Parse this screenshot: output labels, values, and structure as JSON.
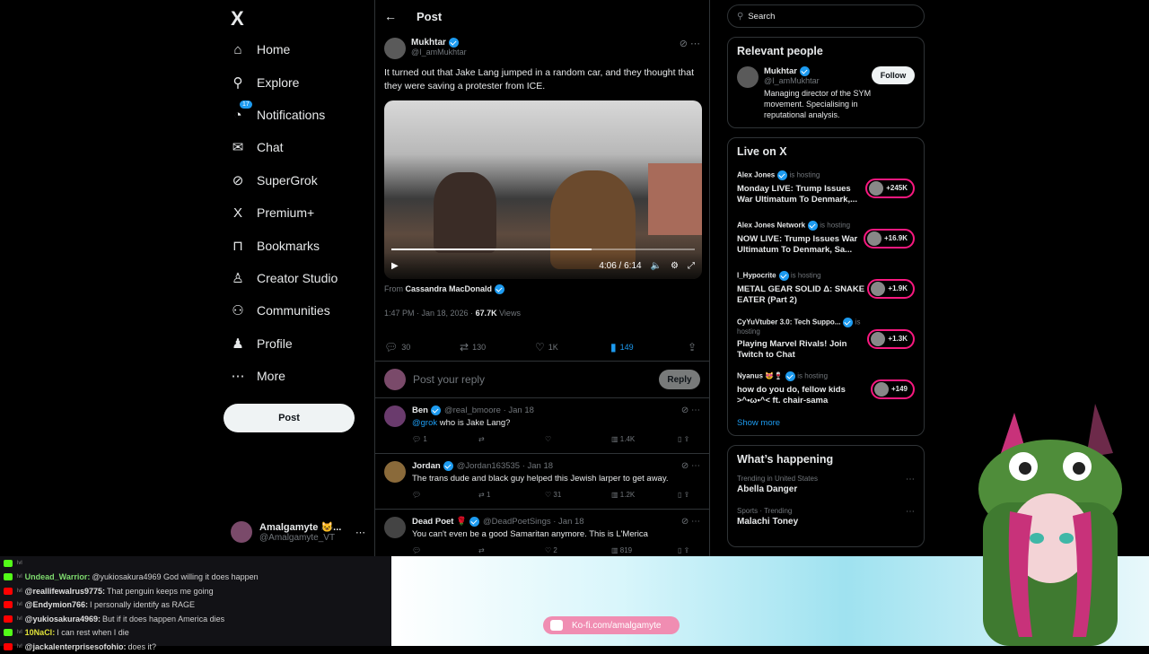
{
  "nav": {
    "logo": "X",
    "items": [
      {
        "label": "Home",
        "icon": "home-icon",
        "glyph": "⌂"
      },
      {
        "label": "Explore",
        "icon": "search-icon",
        "glyph": "⚲"
      },
      {
        "label": "Notifications",
        "icon": "bell-icon",
        "glyph": "🔔",
        "badge": "17"
      },
      {
        "label": "Chat",
        "icon": "mail-icon",
        "glyph": "✉"
      },
      {
        "label": "SuperGrok",
        "icon": "grok-icon",
        "glyph": "⊘"
      },
      {
        "label": "Premium+",
        "icon": "x-icon",
        "glyph": "X"
      },
      {
        "label": "Bookmarks",
        "icon": "bookmark-icon",
        "glyph": "⊓"
      },
      {
        "label": "Creator Studio",
        "icon": "creator-icon",
        "glyph": "♙"
      },
      {
        "label": "Communities",
        "icon": "communities-icon",
        "glyph": "⚇"
      },
      {
        "label": "Profile",
        "icon": "profile-icon",
        "glyph": "♟"
      },
      {
        "label": "More",
        "icon": "more-icon",
        "glyph": "⋯"
      }
    ],
    "post_label": "Post",
    "account": {
      "name": "Amalgamyte 😺...",
      "handle": "@Amalgamyte_VT"
    }
  },
  "main": {
    "title": "Post",
    "post": {
      "name": "Mukhtar",
      "handle": "@I_amMukhtar",
      "text": "It turned out that Jake Lang jumped in a random car, and they thought that they were saving a protester from ICE.",
      "video_time": "4:06 / 6:14",
      "video_progress": 0.66,
      "from_label": "From",
      "from_name": "Cassandra MacDonald",
      "date": "1:47 PM · Jan 18, 2026 · ",
      "views_count": "67.7K",
      "views_label": " Views",
      "replies": "30",
      "reposts": "130",
      "likes": "1K",
      "bookmarks": "149"
    },
    "reply_placeholder": "Post your reply",
    "reply_button": "Reply",
    "replies": [
      {
        "name": "Ben",
        "handle": "@real_bmoore · Jan 18",
        "mention": "@grok",
        "text": " who is Jake Lang?",
        "r": "1",
        "rt": "",
        "l": "",
        "v": "1.4K"
      },
      {
        "name": "Jordan",
        "handle": "@Jordan163535 · Jan 18",
        "mention": "",
        "text": "The trans dude and black guy helped this Jewish larper to get away.",
        "r": "",
        "rt": "1",
        "l": "31",
        "v": "1.2K"
      },
      {
        "name": "Dead Poet 🌹",
        "handle": "@DeadPoetSings · Jan 18",
        "mention": "",
        "text": "You can't even be a good Samaritan anymore. This is L'Merica",
        "r": "",
        "rt": "",
        "l": "2",
        "v": "819"
      }
    ]
  },
  "right": {
    "search_placeholder": "Search",
    "relevant_title": "Relevant people",
    "relevant": {
      "name": "Mukhtar",
      "handle": "@I_amMukhtar",
      "bio": "Managing director of the SYM movement. Specialising in reputational analysis.",
      "follow": "Follow"
    },
    "live_title": "Live on X",
    "is_hosting": "is hosting",
    "live": [
      {
        "host": "Alex Jones",
        "title": "Monday LIVE: Trump Issues War Ultimatum To Denmark,...",
        "count": "+245K"
      },
      {
        "host": "Alex Jones Network",
        "title": "NOW LIVE: Trump Issues War Ultimatum To Denmark, Sa...",
        "count": "+16.9K"
      },
      {
        "host": "I_Hypocrite",
        "title": "METAL GEAR SOLID Δ: SNAKE EATER (Part 2)",
        "count": "+1.9K"
      },
      {
        "host": "CyYuVtuber 3.0: Tech Suppo...",
        "title": "Playing Marvel Rivals! Join Twitch to Chat",
        "count": "+1.3K"
      },
      {
        "host": "Nyanus 😻🍷",
        "title": "how do you do, fellow kids >^•ω•^< ft. chair-sama",
        "count": "+149"
      }
    ],
    "show_more": "Show more",
    "happening_title": "What’s happening",
    "trends": [
      {
        "cat": "Trending in United States",
        "name": "Abella Danger"
      },
      {
        "cat": "Sports · Trending",
        "name": "Malachi Toney"
      }
    ]
  },
  "chat": [
    {
      "user": "",
      "text": "",
      "color": "#7fdc6f",
      "plat": "#53fc18"
    },
    {
      "user": "Undead_Warrior:",
      "text": "@yukiosakura4969 God willing it does happen",
      "color": "#7fdc6f",
      "plat": "#53fc18"
    },
    {
      "user": "@reallifewalrus9775:",
      "text": "That penguin keeps me going",
      "color": "#e0e0e0",
      "plat": "#ff0000"
    },
    {
      "user": "@Endymion766:",
      "text": "I personally identify as RAGE",
      "color": "#e0e0e0",
      "plat": "#ff0000"
    },
    {
      "user": "@yukiosakura4969:",
      "text": "But if it does happen America dies",
      "color": "#e0e0e0",
      "plat": "#ff0000"
    },
    {
      "user": "10NaCl:",
      "text": "I can rest when I die",
      "color": "#e0e23a",
      "plat": "#53fc18"
    },
    {
      "user": "@jackalenterprisesofohio:",
      "text": "does it?",
      "color": "#e0e0e0",
      "plat": "#ff0000"
    }
  ],
  "kofi": "Ko-fi.com/amalgamyte",
  "colors": {
    "accent": "#1d9bf0",
    "live": "#f91880",
    "background": "#000000"
  }
}
